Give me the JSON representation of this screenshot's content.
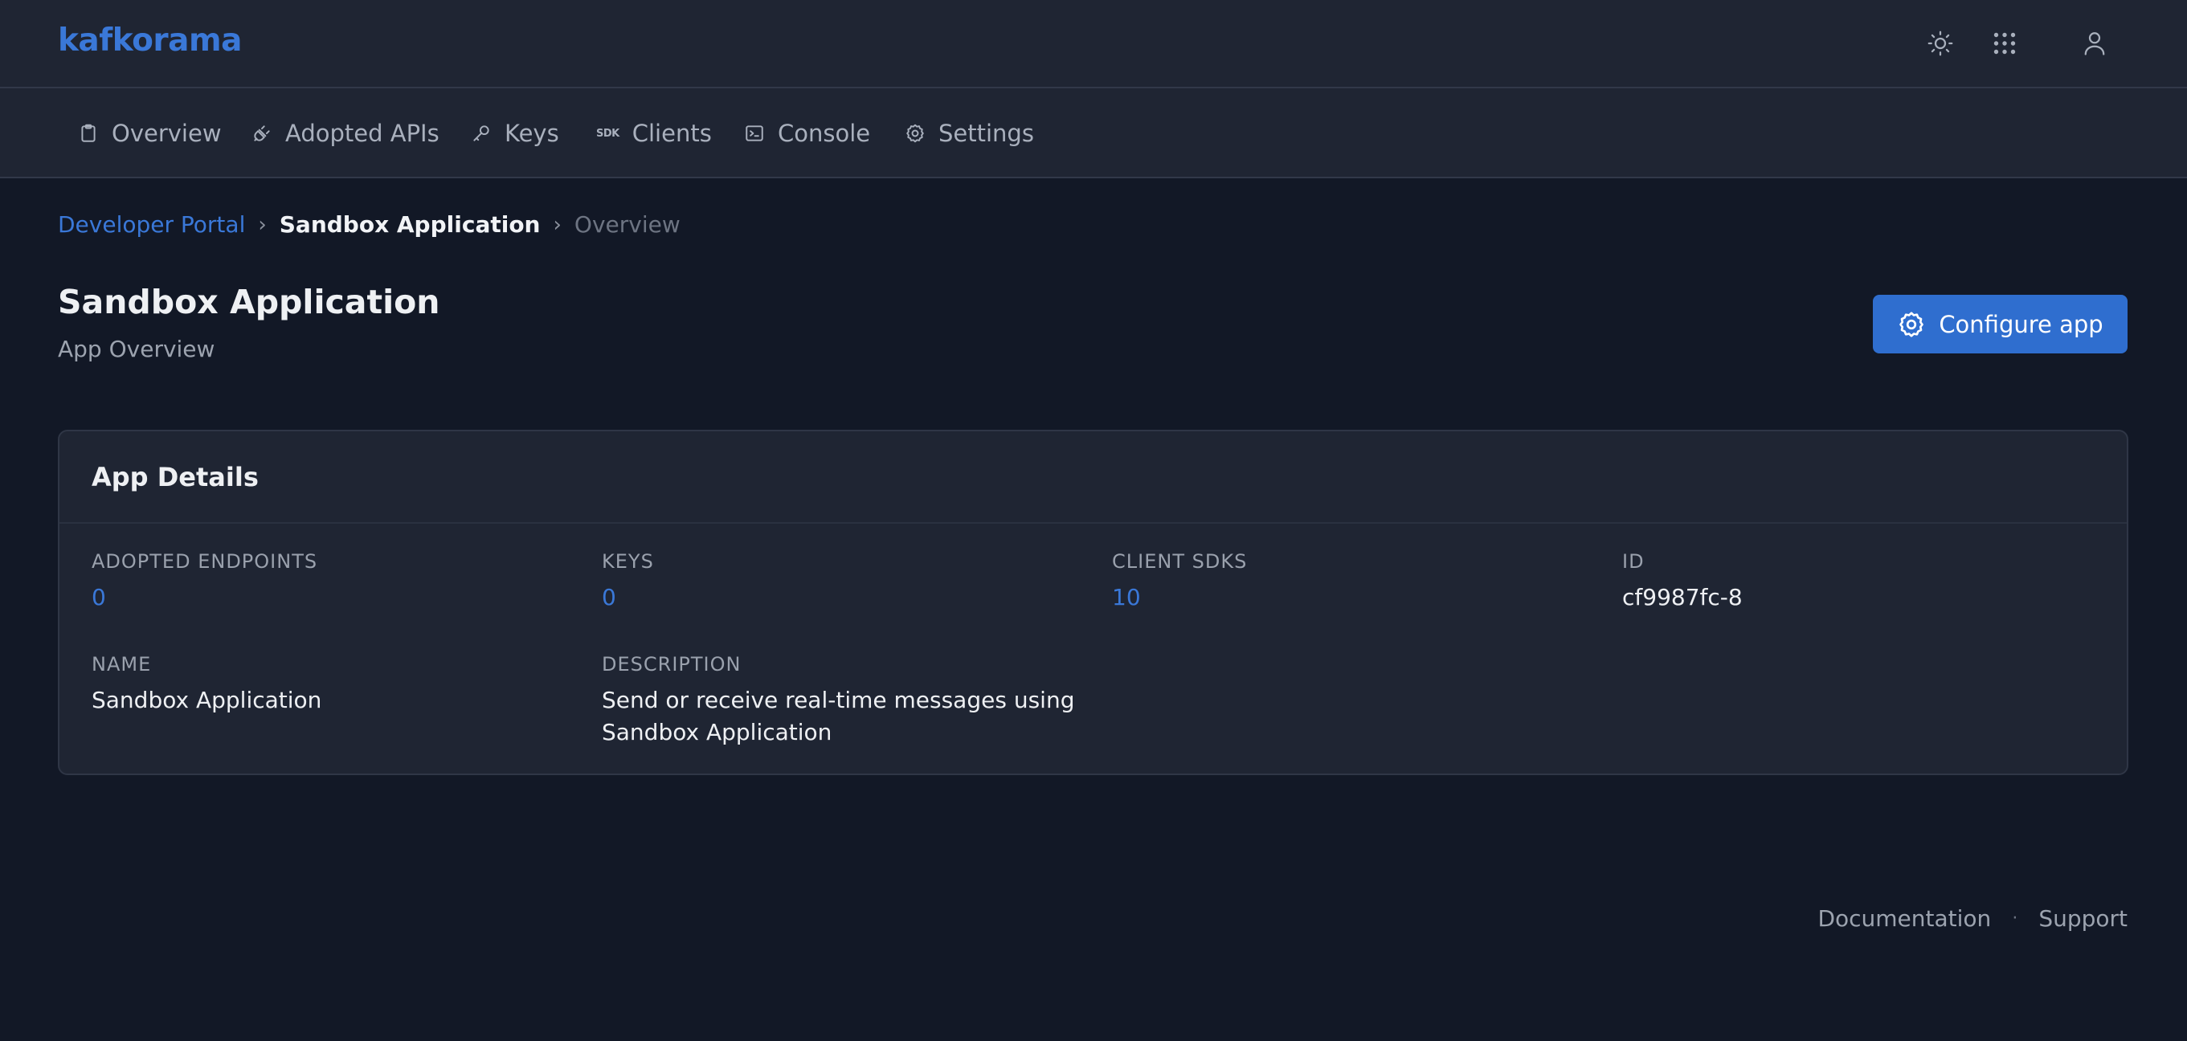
{
  "header": {
    "brand": "kafkorama",
    "icons": [
      "sun-icon",
      "apps-grid-icon",
      "user-icon"
    ]
  },
  "nav": {
    "items": [
      {
        "label": "Overview",
        "icon": "clipboard-icon"
      },
      {
        "label": "Adopted APIs",
        "icon": "plug-icon"
      },
      {
        "label": "Keys",
        "icon": "key-icon"
      },
      {
        "label": "SDK",
        "label2": "Clients",
        "icon": "sdk-icon"
      },
      {
        "label": "Console",
        "icon": "terminal-icon"
      },
      {
        "label": "Settings",
        "icon": "gear-icon"
      }
    ]
  },
  "breadcrumb": {
    "root": "Developer Portal",
    "current": "Sandbox Application",
    "last": "Overview"
  },
  "page": {
    "title": "Sandbox Application",
    "subtitle": "App Overview",
    "configure_label": "Configure app"
  },
  "card": {
    "title": "App Details",
    "fields": {
      "adopted_endpoints": {
        "label": "ADOPTED ENDPOINTS",
        "value": "0"
      },
      "keys": {
        "label": "KEYS",
        "value": "0"
      },
      "client_sdks": {
        "label": "CLIENT SDKS",
        "value": "10"
      },
      "id": {
        "label": "ID",
        "value": "cf9987fc-8"
      },
      "name": {
        "label": "NAME",
        "value": "Sandbox Application"
      },
      "description": {
        "label": "DESCRIPTION",
        "line1": "Send or receive real-time messages using",
        "line2": "Sandbox Application"
      }
    }
  },
  "footer": {
    "documentation": "Documentation",
    "separator": "·",
    "support": "Support"
  },
  "colors": {
    "accent": "#3a78d8",
    "button": "#2f6ecf",
    "background": "#121826",
    "surface": "#1f2533"
  }
}
